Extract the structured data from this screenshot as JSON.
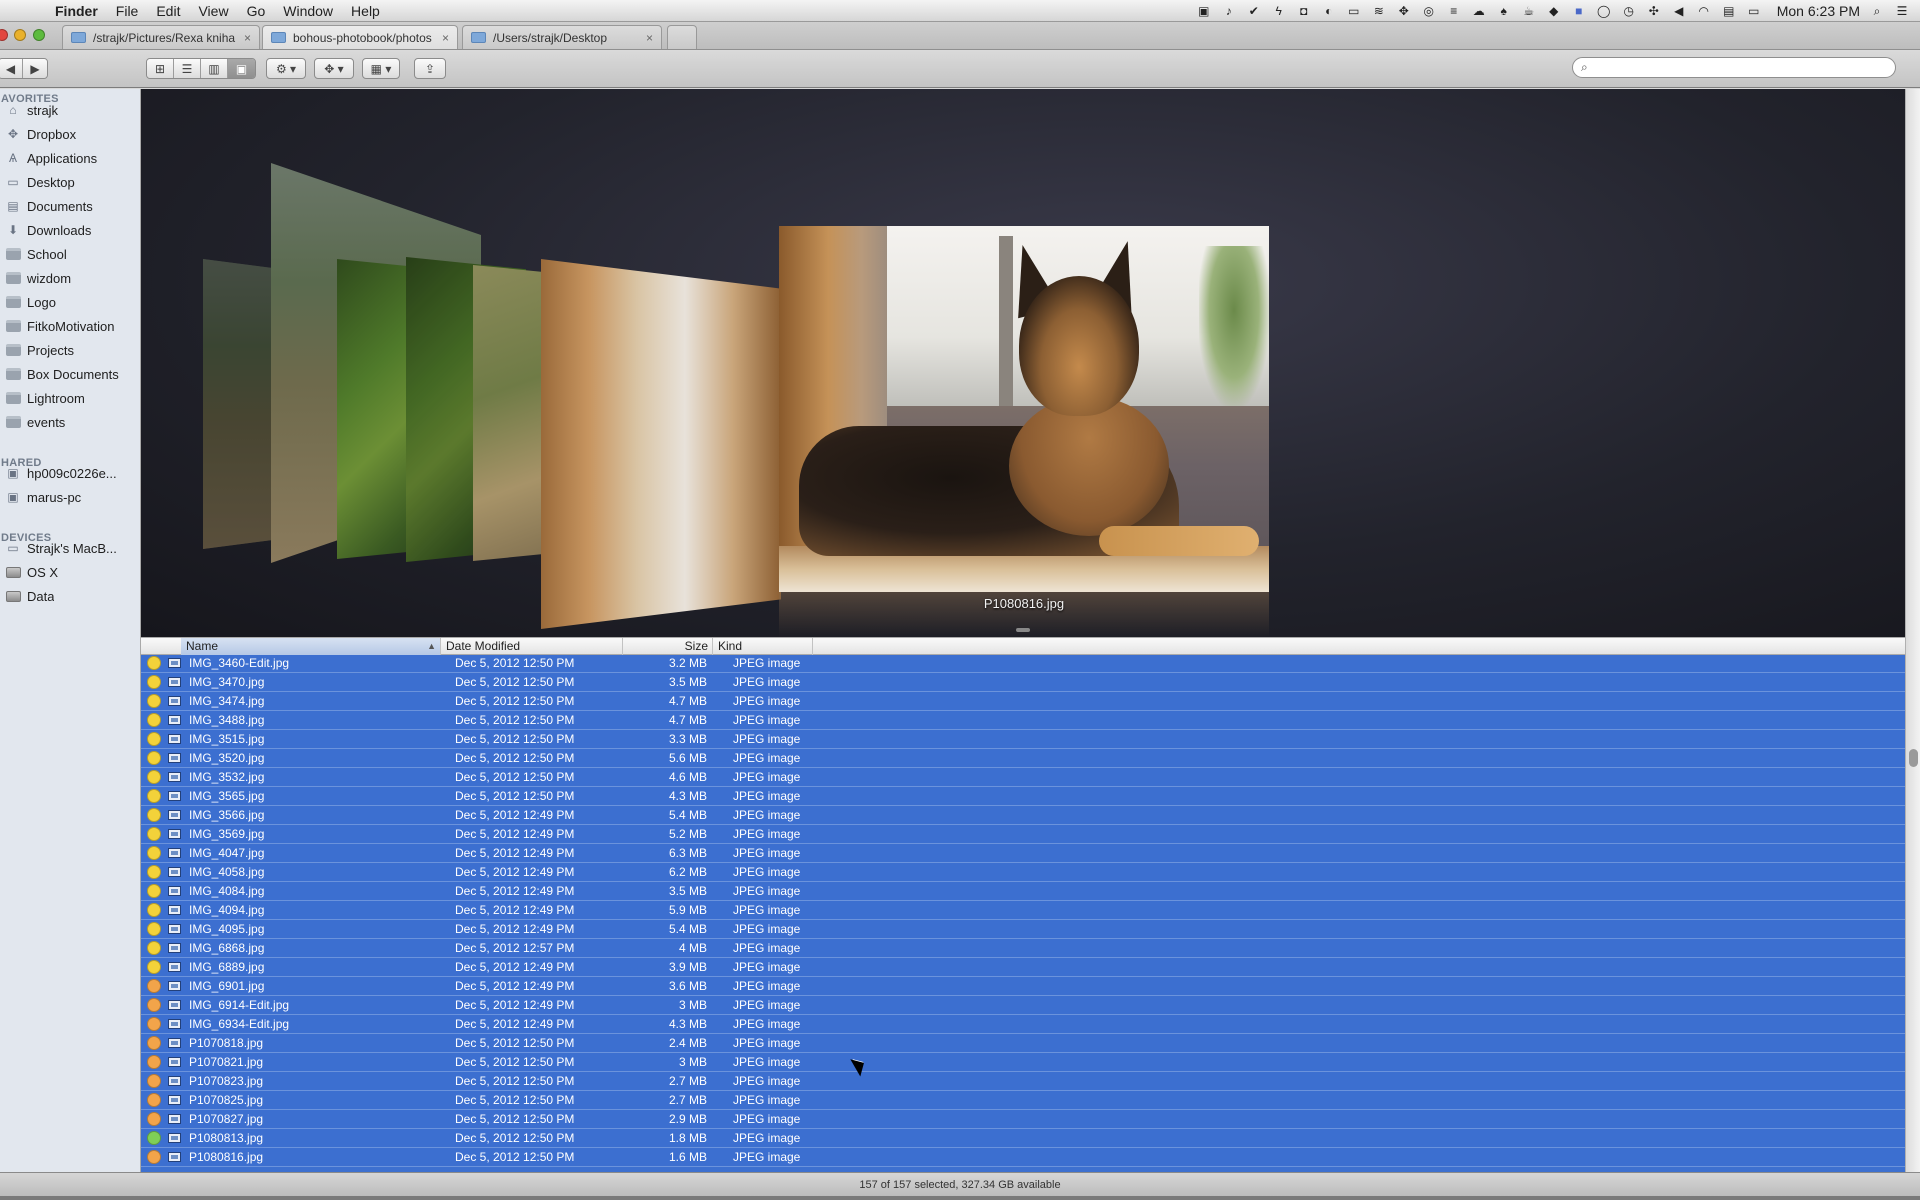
{
  "menubar": {
    "app": "Finder",
    "menus": [
      "File",
      "Edit",
      "View",
      "Go",
      "Window",
      "Help"
    ],
    "clock": "Mon 6:23 PM"
  },
  "tabs": [
    {
      "label": "/strajk/Pictures/Rexa kniha",
      "close": "×"
    },
    {
      "label": "bohous-photobook/photos",
      "close": "×"
    },
    {
      "label": "/Users/strajk/Desktop",
      "close": "×"
    }
  ],
  "toolbar": {
    "back": "◀",
    "forward": "▶",
    "view_icons": "⊞",
    "view_list": "☰",
    "view_columns": "▥",
    "view_coverflow": "▣",
    "action": "⚙ ▾",
    "dropbox": "✥ ▾",
    "arrange": "▦ ▾",
    "share": "⇪",
    "search_placeholder": ""
  },
  "sidebar": {
    "favorites_header": "AVORITES",
    "shared_header": "HARED",
    "devices_header": "DEVICES",
    "favorites": [
      {
        "label": "strajk",
        "icon": "house-icon"
      },
      {
        "label": "Dropbox",
        "icon": "dropbox-icon"
      },
      {
        "label": "Applications",
        "icon": "applications-icon"
      },
      {
        "label": "Desktop",
        "icon": "desktop-icon"
      },
      {
        "label": "Documents",
        "icon": "documents-icon"
      },
      {
        "label": "Downloads",
        "icon": "downloads-icon"
      },
      {
        "label": "School",
        "icon": "folder-icon"
      },
      {
        "label": "wizdom",
        "icon": "folder-icon"
      },
      {
        "label": "Logo",
        "icon": "folder-icon"
      },
      {
        "label": "FitkoMotivation",
        "icon": "folder-icon"
      },
      {
        "label": "Projects",
        "icon": "folder-icon"
      },
      {
        "label": "Box Documents",
        "icon": "folder-icon"
      },
      {
        "label": "Lightroom",
        "icon": "folder-icon"
      },
      {
        "label": "events",
        "icon": "folder-icon"
      }
    ],
    "shared": [
      {
        "label": "hp009c0226e...",
        "icon": "network-computer-icon"
      },
      {
        "label": "marus-pc",
        "icon": "network-computer-icon"
      }
    ],
    "devices": [
      {
        "label": "Strajk's MacB...",
        "icon": "laptop-icon"
      },
      {
        "label": "OS X",
        "icon": "drive-icon"
      },
      {
        "label": "Data",
        "icon": "drive-icon"
      }
    ]
  },
  "coverflow": {
    "caption": "P1080816.jpg"
  },
  "columns": {
    "name": "Name",
    "date": "Date Modified",
    "size": "Size",
    "kind": "Kind",
    "sort_arrow": "▲"
  },
  "colors": {
    "tag_yellow": "#f3d23a",
    "tag_orange": "#f2a44a",
    "tag_green": "#7fcf56",
    "selection": "#3c6fd0"
  },
  "files": [
    {
      "tag": "yellow",
      "name": "IMG_3460-Edit.jpg",
      "date": "Dec 5, 2012 12:50 PM",
      "size": "3.2 MB",
      "kind": "JPEG image"
    },
    {
      "tag": "yellow",
      "name": "IMG_3470.jpg",
      "date": "Dec 5, 2012 12:50 PM",
      "size": "3.5 MB",
      "kind": "JPEG image"
    },
    {
      "tag": "yellow",
      "name": "IMG_3474.jpg",
      "date": "Dec 5, 2012 12:50 PM",
      "size": "4.7 MB",
      "kind": "JPEG image"
    },
    {
      "tag": "yellow",
      "name": "IMG_3488.jpg",
      "date": "Dec 5, 2012 12:50 PM",
      "size": "4.7 MB",
      "kind": "JPEG image"
    },
    {
      "tag": "yellow",
      "name": "IMG_3515.jpg",
      "date": "Dec 5, 2012 12:50 PM",
      "size": "3.3 MB",
      "kind": "JPEG image"
    },
    {
      "tag": "yellow",
      "name": "IMG_3520.jpg",
      "date": "Dec 5, 2012 12:50 PM",
      "size": "5.6 MB",
      "kind": "JPEG image"
    },
    {
      "tag": "yellow",
      "name": "IMG_3532.jpg",
      "date": "Dec 5, 2012 12:50 PM",
      "size": "4.6 MB",
      "kind": "JPEG image"
    },
    {
      "tag": "yellow",
      "name": "IMG_3565.jpg",
      "date": "Dec 5, 2012 12:50 PM",
      "size": "4.3 MB",
      "kind": "JPEG image"
    },
    {
      "tag": "yellow",
      "name": "IMG_3566.jpg",
      "date": "Dec 5, 2012 12:49 PM",
      "size": "5.4 MB",
      "kind": "JPEG image"
    },
    {
      "tag": "yellow",
      "name": "IMG_3569.jpg",
      "date": "Dec 5, 2012 12:49 PM",
      "size": "5.2 MB",
      "kind": "JPEG image"
    },
    {
      "tag": "yellow",
      "name": "IMG_4047.jpg",
      "date": "Dec 5, 2012 12:49 PM",
      "size": "6.3 MB",
      "kind": "JPEG image"
    },
    {
      "tag": "yellow",
      "name": "IMG_4058.jpg",
      "date": "Dec 5, 2012 12:49 PM",
      "size": "6.2 MB",
      "kind": "JPEG image"
    },
    {
      "tag": "yellow",
      "name": "IMG_4084.jpg",
      "date": "Dec 5, 2012 12:49 PM",
      "size": "3.5 MB",
      "kind": "JPEG image"
    },
    {
      "tag": "yellow",
      "name": "IMG_4094.jpg",
      "date": "Dec 5, 2012 12:49 PM",
      "size": "5.9 MB",
      "kind": "JPEG image"
    },
    {
      "tag": "yellow",
      "name": "IMG_4095.jpg",
      "date": "Dec 5, 2012 12:49 PM",
      "size": "5.4 MB",
      "kind": "JPEG image"
    },
    {
      "tag": "yellow",
      "name": "IMG_6868.jpg",
      "date": "Dec 5, 2012 12:57 PM",
      "size": "4 MB",
      "kind": "JPEG image"
    },
    {
      "tag": "yellow",
      "name": "IMG_6889.jpg",
      "date": "Dec 5, 2012 12:49 PM",
      "size": "3.9 MB",
      "kind": "JPEG image"
    },
    {
      "tag": "orange",
      "name": "IMG_6901.jpg",
      "date": "Dec 5, 2012 12:49 PM",
      "size": "3.6 MB",
      "kind": "JPEG image"
    },
    {
      "tag": "orange",
      "name": "IMG_6914-Edit.jpg",
      "date": "Dec 5, 2012 12:49 PM",
      "size": "3 MB",
      "kind": "JPEG image"
    },
    {
      "tag": "orange",
      "name": "IMG_6934-Edit.jpg",
      "date": "Dec 5, 2012 12:49 PM",
      "size": "4.3 MB",
      "kind": "JPEG image"
    },
    {
      "tag": "orange",
      "name": "P1070818.jpg",
      "date": "Dec 5, 2012 12:50 PM",
      "size": "2.4 MB",
      "kind": "JPEG image"
    },
    {
      "tag": "orange",
      "name": "P1070821.jpg",
      "date": "Dec 5, 2012 12:50 PM",
      "size": "3 MB",
      "kind": "JPEG image"
    },
    {
      "tag": "orange",
      "name": "P1070823.jpg",
      "date": "Dec 5, 2012 12:50 PM",
      "size": "2.7 MB",
      "kind": "JPEG image"
    },
    {
      "tag": "orange",
      "name": "P1070825.jpg",
      "date": "Dec 5, 2012 12:50 PM",
      "size": "2.7 MB",
      "kind": "JPEG image"
    },
    {
      "tag": "orange",
      "name": "P1070827.jpg",
      "date": "Dec 5, 2012 12:50 PM",
      "size": "2.9 MB",
      "kind": "JPEG image"
    },
    {
      "tag": "green",
      "name": "P1080813.jpg",
      "date": "Dec 5, 2012 12:50 PM",
      "size": "1.8 MB",
      "kind": "JPEG image"
    },
    {
      "tag": "orange",
      "name": "P1080816.jpg",
      "date": "Dec 5, 2012 12:50 PM",
      "size": "1.6 MB",
      "kind": "JPEG image"
    }
  ],
  "status": "157 of 157 selected, 327.34 GB available"
}
